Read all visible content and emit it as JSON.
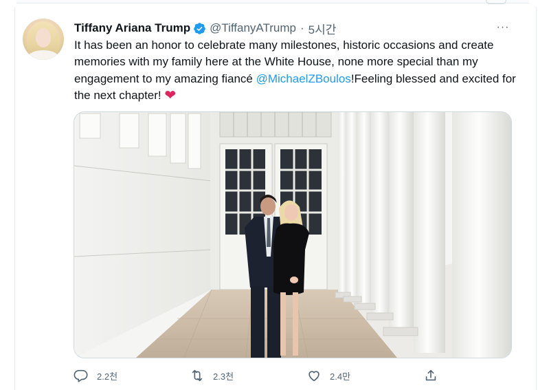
{
  "tweet": {
    "author_name": "Tiffany Ariana Trump",
    "handle": "@TiffanyATrump",
    "separator": "·",
    "time": "5시간",
    "more_label": "···",
    "text_part1": "It has been an honor to celebrate many milestones, historic occasions and create memories with my family here at the White House, none more special than my engagement to my amazing fiancé ",
    "mention": "@MichaelZBoulos",
    "text_part2": "!Feeling blessed and excited for the next chapter! ",
    "heart": "❤",
    "verified_icon": "verified-badge-icon",
    "brand_color": "#1d9bf0"
  },
  "actions": {
    "reply_count": "2.2천",
    "retweet_count": "2.3천",
    "like_count": "2.4만",
    "icons": [
      "reply-icon",
      "retweet-icon",
      "like-icon",
      "share-icon"
    ]
  }
}
